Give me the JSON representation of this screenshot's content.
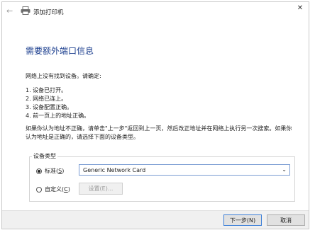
{
  "titlebar": {
    "close_glyph": "✕"
  },
  "nav": {
    "back_glyph": "←",
    "title": "添加打印机"
  },
  "heading": "需要额外端口信息",
  "intro": "网络上没有找到设备。请确定:",
  "checklist": [
    "1.  设备已打开。",
    "2.  网络已连上。",
    "3.  设备配置正确。",
    "4.  前一页上的地址正确。"
  ],
  "paragraph": "如果你认为地址不正确，请单击\"上一步\"返回到上一页，然后改正地址并在网络上执行另一次搜索。如果你认为地址是正确的，请选择下面的设备类型。",
  "device_type": {
    "group_label": "设备类型",
    "standard_label": "标准(",
    "standard_key": "S",
    "standard_end": ")",
    "standard_selected": true,
    "standard_value": "Generic Network Card",
    "custom_label": "自定义(",
    "custom_key": "C",
    "custom_end": ")",
    "settings_button": "设置(E)..."
  },
  "footer": {
    "next_button": "下一步(N)",
    "cancel_button": "取消"
  },
  "colors": {
    "heading": "#1c3f8f",
    "accent_border": "#3c7fd8",
    "footer_bg": "#f0f0f0"
  }
}
